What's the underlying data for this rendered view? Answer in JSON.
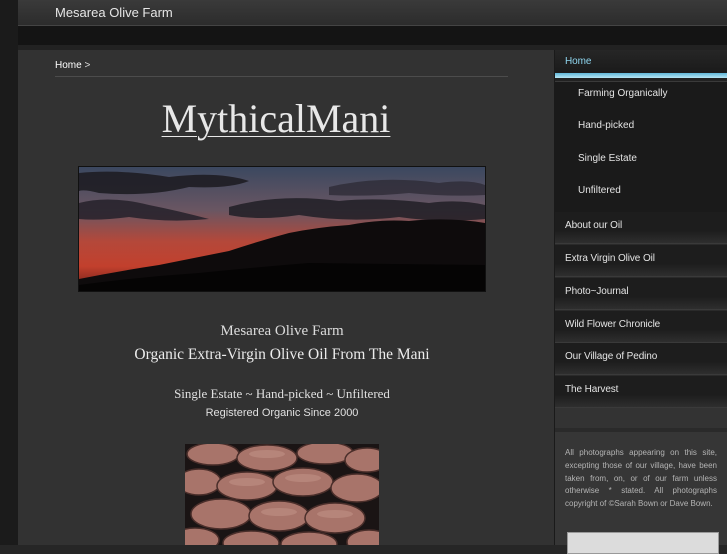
{
  "header": {
    "site_title": "Mesarea Olive Farm"
  },
  "breadcrumb": {
    "home": "Home",
    "separator": ">"
  },
  "main": {
    "logo": "MythicalMani",
    "farm_name": "Mesarea Olive Farm",
    "headline": "Organic Extra-Virgin Olive Oil From The Mani",
    "tagline": "Single Estate ~ Hand-picked ~ Unfiltered",
    "registered": "Registered Organic Since 2000"
  },
  "sidebar": {
    "items": [
      {
        "label": "Home",
        "active": true
      },
      {
        "label": "About our Oil"
      },
      {
        "label": "Extra Virgin Olive Oil"
      },
      {
        "label": "Photo~Journal"
      },
      {
        "label": "Wild Flower Chronicle"
      },
      {
        "label": "Our Village of Pedino"
      },
      {
        "label": "The Harvest"
      }
    ],
    "sub_items": [
      {
        "label": "Farming Organically"
      },
      {
        "label": "Hand-picked"
      },
      {
        "label": "Single Estate"
      },
      {
        "label": "Unfiltered"
      }
    ],
    "note": "All photographs appearing on this site, excepting those of our village, have been taken from, on, or of our farm unless otherwise * stated. All photographs copyright of ©Sarah Bown or Dave Bown."
  },
  "colors": {
    "accent": "#8fd6ef",
    "active_bar": "#5fb6d8"
  }
}
